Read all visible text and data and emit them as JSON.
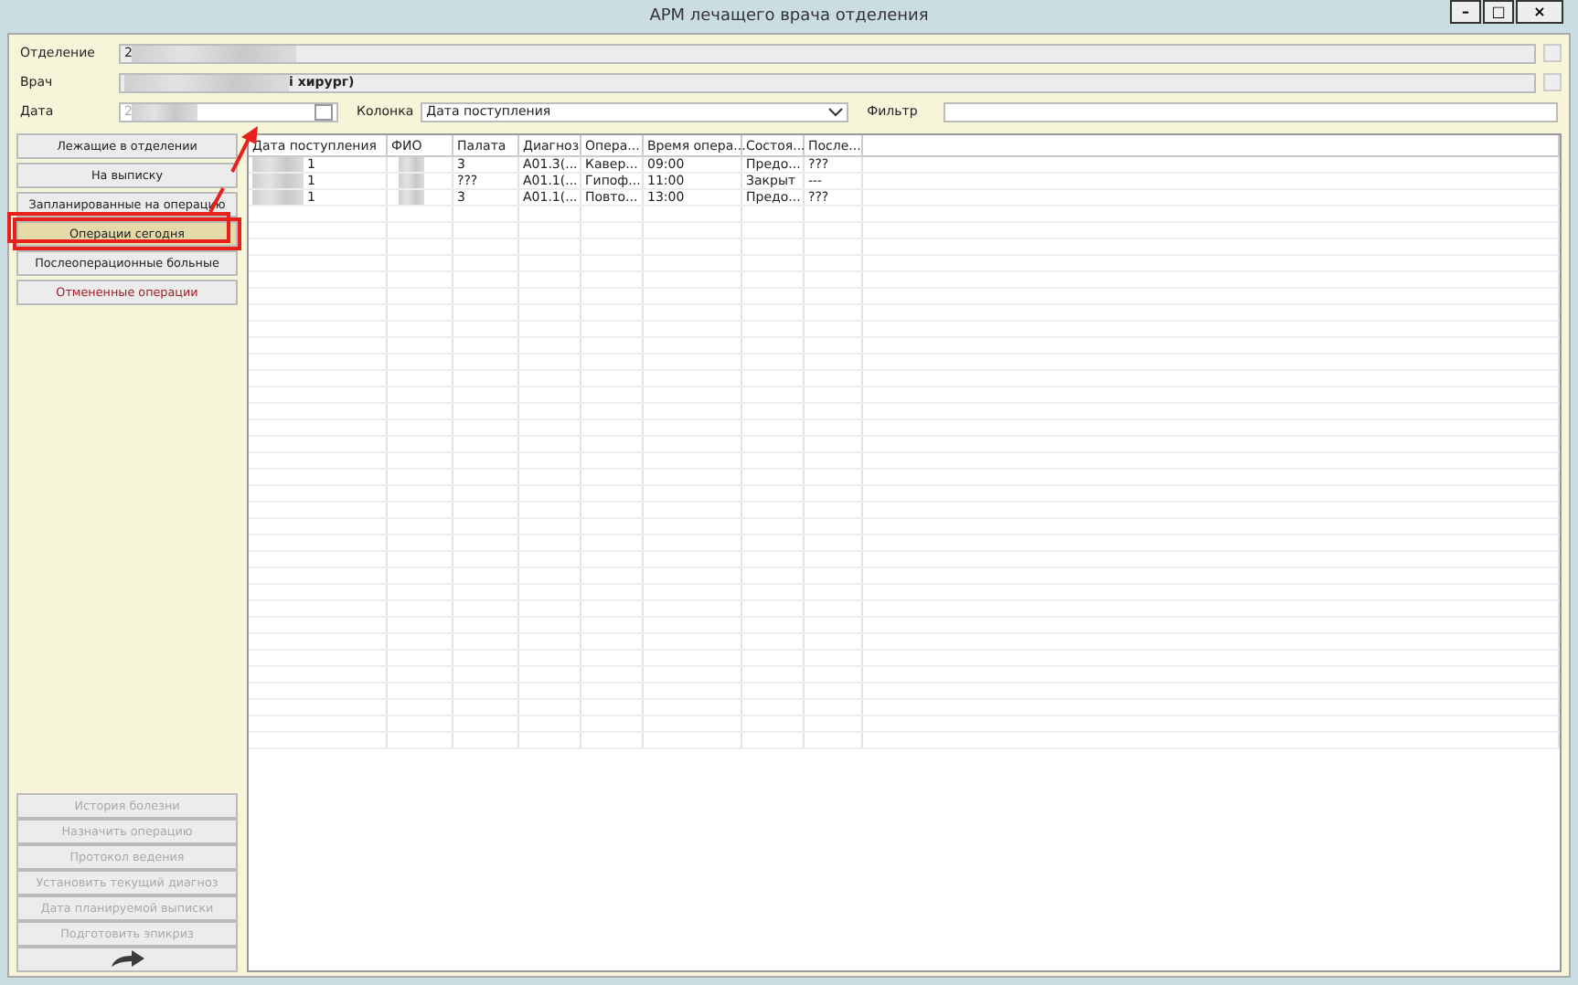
{
  "window": {
    "title": "АРМ лечащего врача отделения",
    "controls": [
      "–",
      "□",
      "×"
    ]
  },
  "filters": {
    "department_label": "Отделение",
    "department_value": "2",
    "doctor_label": "Врач",
    "doctor_value": "і хирург)",
    "date_label": "Дата",
    "date_value": "2",
    "column_label": "Колонка",
    "column_value": "Дата поступления",
    "filter_label": "Фильтр"
  },
  "nav": [
    {
      "label": "Лежащие в отделении",
      "selected": false,
      "kind": "normal"
    },
    {
      "label": "На выписку",
      "selected": false,
      "kind": "normal"
    },
    {
      "label": "Запланированные на операцию",
      "selected": false,
      "kind": "normal"
    },
    {
      "label": "Операции сегодня",
      "selected": true,
      "kind": "normal"
    },
    {
      "label": "Послеоперационные больные",
      "selected": false,
      "kind": "normal"
    },
    {
      "label": "Отмененные операции",
      "selected": false,
      "kind": "warning"
    }
  ],
  "actions": [
    {
      "label": "История болезни",
      "disabled": true
    },
    {
      "label": "Назначить операцию",
      "disabled": true
    },
    {
      "label": "Протокол ведения",
      "disabled": true
    },
    {
      "label": "Установить текущий диагноз",
      "disabled": true
    },
    {
      "label": "Дата планируемой выписки",
      "disabled": true
    },
    {
      "label": "Подготовить эпикриз",
      "disabled": true
    }
  ],
  "table": {
    "columns": [
      "Дата поступления",
      "ФИО",
      "Палата",
      "Диагноз",
      "Опера...",
      "Время опера...",
      "Состоя...",
      "После..."
    ],
    "rows": [
      [
        "1",
        "",
        "3",
        "А01.3(...",
        "Кавер...",
        "09:00",
        "Предо...",
        "???"
      ],
      [
        "1",
        "",
        "???",
        "А01.1(...",
        "Гипоф...",
        "11:00",
        "Закрыт",
        "---"
      ],
      [
        "1",
        "",
        "3",
        "А01.1(...",
        "Повто...",
        "13:00",
        "Предо...",
        "???"
      ]
    ]
  }
}
